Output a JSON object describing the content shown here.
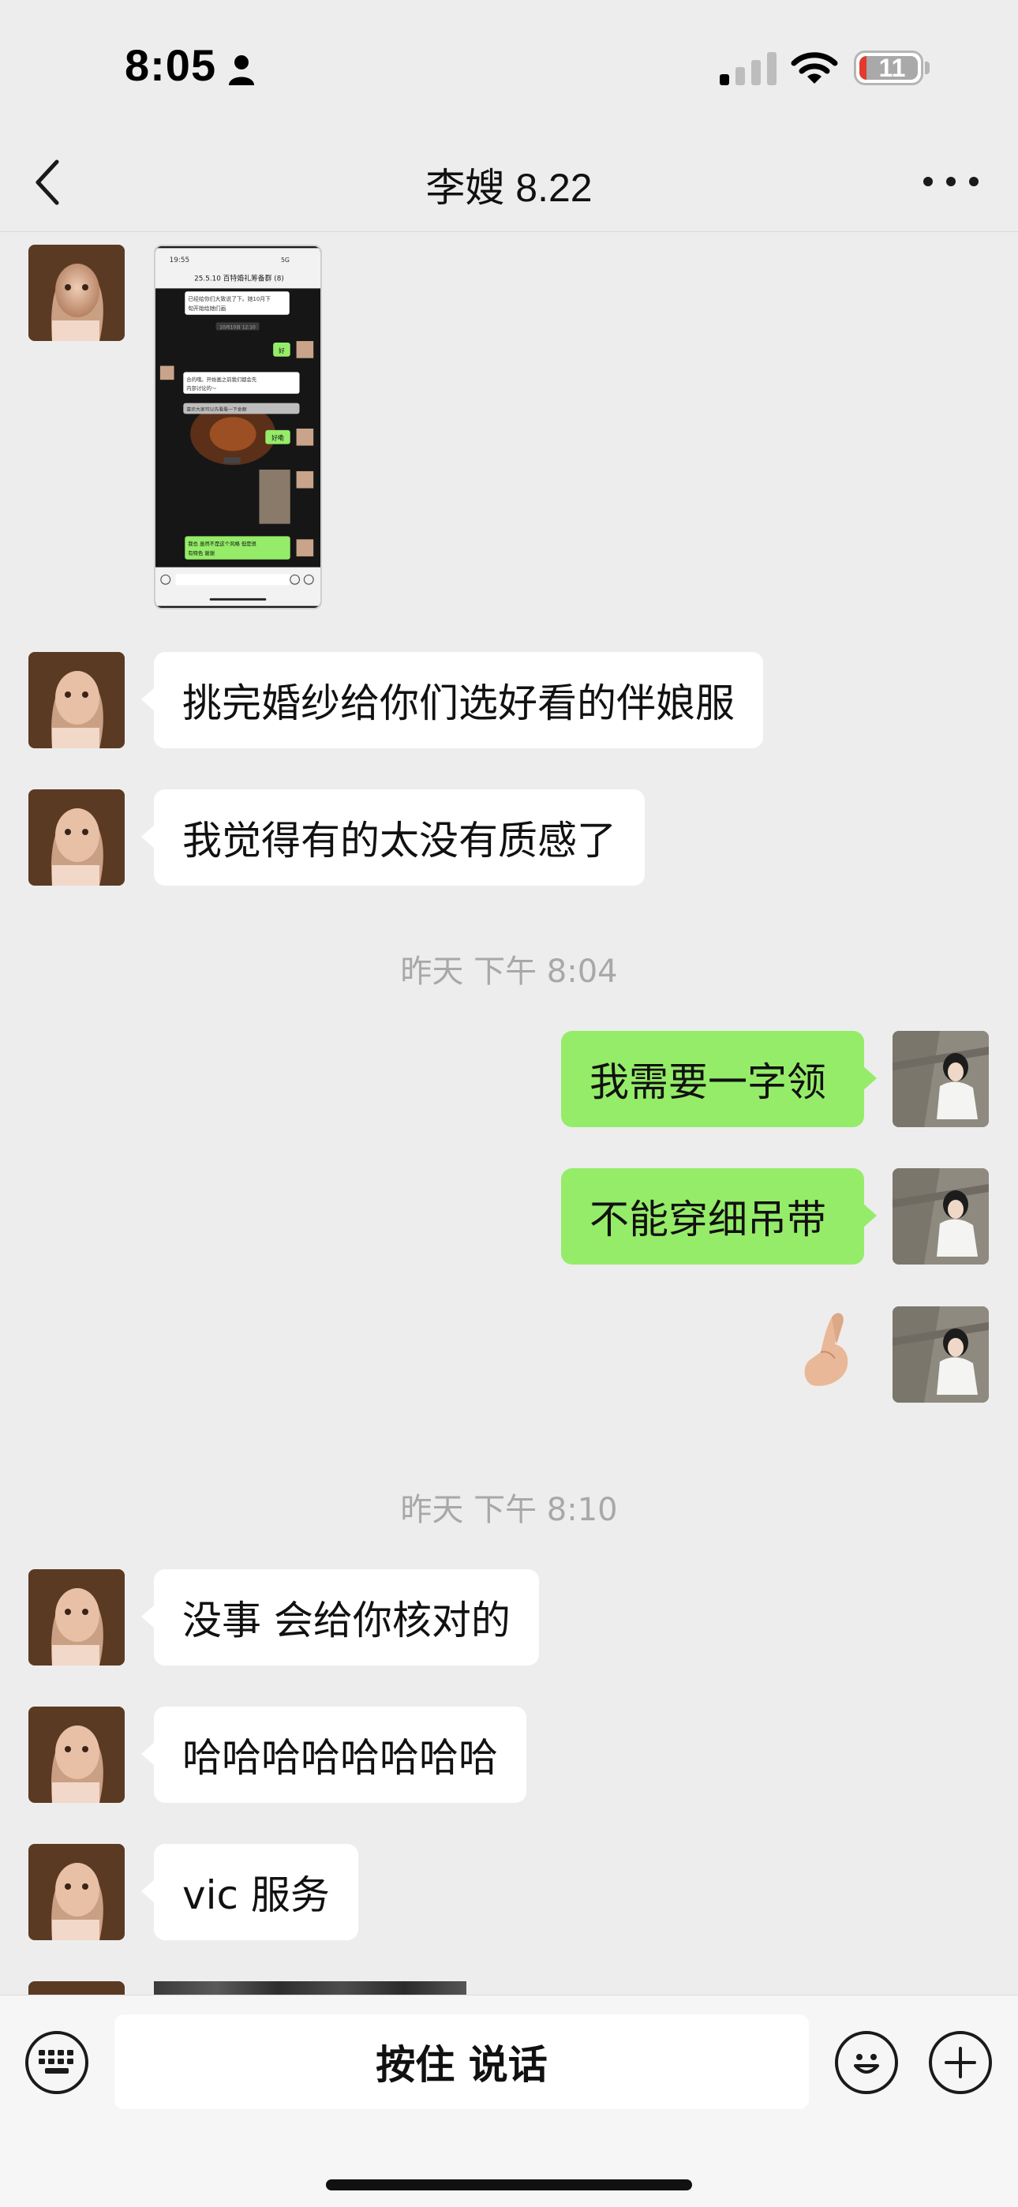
{
  "status_bar": {
    "time": "8:05",
    "battery_level": "11",
    "icons": [
      "person-icon",
      "cellular-signal-icon",
      "wifi-icon",
      "battery-icon"
    ]
  },
  "nav": {
    "title": "李嫂 8.22",
    "back_icon": "chevron-left-icon",
    "more_icon": "more-dots-icon"
  },
  "thumbnail": {
    "header": "25.5.10 百特婚礼筹备群 (8)",
    "status_time": "19:55",
    "status_signal": "5G",
    "line1": "已经给你们大致说了下。她10月下",
    "line2": "旬开始给她们画",
    "time_label": "10月10日 12:10",
    "reply_ok": "好",
    "incoming1_line1": "合的哦。开始画之前我们都会先",
    "incoming1_line2": "内部讨论的～",
    "incoming2": "喜欢大家可以先看看一下金额",
    "reply_ok2": "好嘞",
    "outgoing_line1": "我也 虽然不是这个风格 但是很",
    "outgoing_line2": "有特色 谢谢"
  },
  "messages": {
    "m1": "挑完婚纱给你们选好看的伴娘服",
    "m2": "我觉得有的太没有质感了",
    "ts1": "昨天 下午 8:04",
    "m3": "我需要一字领",
    "m4": "不能穿细吊带",
    "ts2": "昨天 下午 8:10",
    "m5": "没事 会给你核对的",
    "m6": "哈哈哈哈哈哈哈哈",
    "m7": "vic 服务"
  },
  "input_bar": {
    "voice_label": "按住 说话",
    "keyboard_icon": "keyboard-icon",
    "emoji_icon": "smiley-icon",
    "plus_icon": "plus-icon"
  },
  "colors": {
    "background": "#ededed",
    "outgoing_bubble": "#95ec69",
    "incoming_bubble": "#ffffff",
    "timestamp_text": "#a8a8a8",
    "battery_low": "#e23b2e"
  }
}
